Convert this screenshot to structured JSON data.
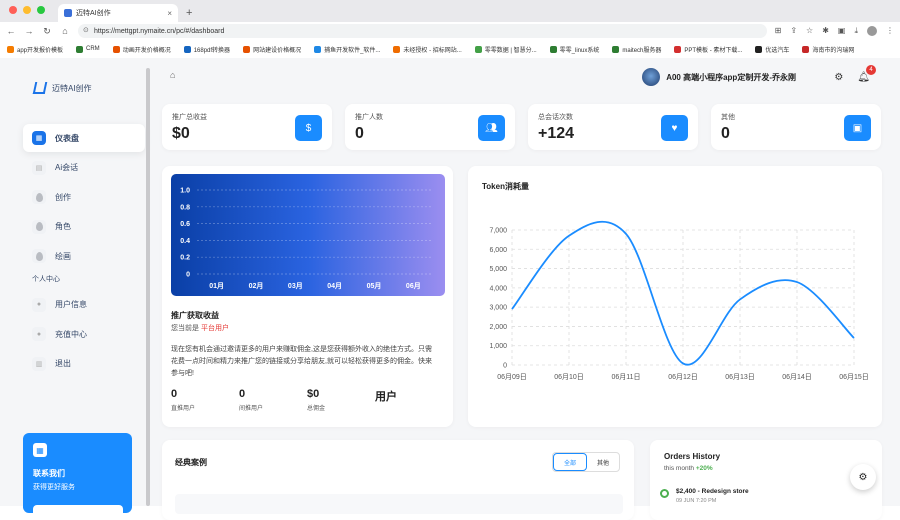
{
  "browser": {
    "tab_title": "迈特AI创作",
    "url": "https://mettgpt.nymaite.cn/pc/#/dashboard",
    "bookmarks": [
      {
        "label": "app开发报价模板",
        "color": "#f57c00"
      },
      {
        "label": "CRM",
        "color": "#2e7d32"
      },
      {
        "label": "动画开发价格概况",
        "color": "#e65100"
      },
      {
        "label": "168pdf转换器",
        "color": "#1565c0"
      },
      {
        "label": "网站建设价格概况",
        "color": "#e65100"
      },
      {
        "label": "捕鱼开发软件_软件...",
        "color": "#1e88e5"
      },
      {
        "label": "未经授权 - 招标网站...",
        "color": "#ef6c00"
      },
      {
        "label": "零零数据 | 智慧分...",
        "color": "#43a047"
      },
      {
        "label": "零零_linux系统",
        "color": "#2e7d32"
      },
      {
        "label": "maitech服务器",
        "color": "#2e7d32"
      },
      {
        "label": "PPT模板 - 素材下载...",
        "color": "#d32f2f"
      },
      {
        "label": "优选汽车",
        "color": "#212121"
      },
      {
        "label": "海南市的沟瑞网",
        "color": "#c62828"
      }
    ]
  },
  "sidebar": {
    "brand": "迈特AI创作",
    "items": [
      {
        "label": "仪表盘",
        "active": true
      },
      {
        "label": "Ai会话"
      },
      {
        "label": "创作"
      },
      {
        "label": "角色"
      },
      {
        "label": "绘画"
      }
    ],
    "section": "个人中心",
    "personal": [
      {
        "label": "用户信息"
      },
      {
        "label": "充值中心"
      },
      {
        "label": "退出"
      }
    ],
    "promo": {
      "title": "联系我们",
      "subtitle": "获得更好服务"
    }
  },
  "header": {
    "user_name": "A00 高端小程序app定制开发-乔永刚",
    "notifications": "4"
  },
  "stats": [
    {
      "label": "推广总收益",
      "value": "$0",
      "icon": "dollar-icon"
    },
    {
      "label": "推广人数",
      "value": "0",
      "icon": "users-icon"
    },
    {
      "label": "总会话次数",
      "value": "+124",
      "icon": "heart-icon"
    },
    {
      "label": "其他",
      "value": "0",
      "icon": "bag-icon"
    }
  ],
  "earn": {
    "title": "推广获取收益",
    "sub_prefix": "您当前是",
    "sub_role": "平台用户",
    "desc": "现在您有机会通过邀请更多的用户来赚取佣金,这是您获得额外收入的绝佳方式。只需花费一点时间和精力来推广您的链接或分享给朋友,就可以轻松获得更多的佣金。快来参与吧!",
    "kpis": [
      {
        "value": "0",
        "label": "直推用户"
      },
      {
        "value": "0",
        "label": "间推用户"
      },
      {
        "value": "$0",
        "label": "总佣金"
      },
      {
        "value": "用户",
        "label": ""
      }
    ]
  },
  "chart_data": [
    {
      "type": "line",
      "title": "",
      "categories": [
        "01月",
        "02月",
        "03月",
        "04月",
        "05月",
        "06月"
      ],
      "ylim": [
        0,
        1.0
      ],
      "yticks": [
        "0",
        "0.2",
        "0.4",
        "0.6",
        "0.8",
        "1.0"
      ],
      "series": [
        {
          "values": [
            0,
            0,
            0,
            0,
            0,
            0
          ]
        }
      ],
      "grid": true
    },
    {
      "type": "line",
      "title": "Token消耗量",
      "categories": [
        "06月09日",
        "06月10日",
        "06月11日",
        "06月12日",
        "06月13日",
        "06月14日",
        "06月15日"
      ],
      "ylim": [
        0,
        7000
      ],
      "yticks": [
        "0",
        "1,000",
        "2,000",
        "3,000",
        "4,000",
        "5,000",
        "6,000",
        "7,000"
      ],
      "series": [
        {
          "values": [
            2900,
            6700,
            6800,
            80,
            3400,
            4300,
            1400
          ]
        }
      ],
      "grid": true,
      "color": "#1a8cff"
    }
  ],
  "cases": {
    "title": "经典案例",
    "tabs": [
      "全部",
      "其他"
    ]
  },
  "orders": {
    "title": "Orders History",
    "sub": "this month",
    "growth": "+20%",
    "items": [
      {
        "title": "$2,400 - Redesign store",
        "date": "09 JUN 7:20 PM"
      }
    ]
  }
}
